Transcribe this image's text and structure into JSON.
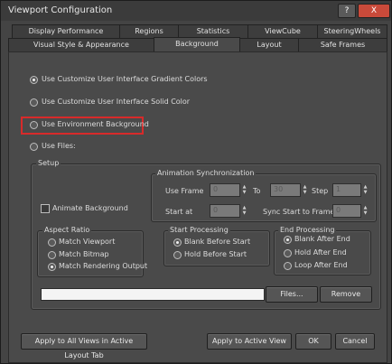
{
  "window": {
    "title": "Viewport Configuration",
    "help": "?",
    "close": "X"
  },
  "tabs_row1": [
    "Display Performance",
    "Regions",
    "Statistics",
    "ViewCube",
    "SteeringWheels"
  ],
  "tabs_row2": [
    "Visual Style & Appearance",
    "Background",
    "Layout",
    "Safe Frames"
  ],
  "options": {
    "gradient": "Use Customize User Interface Gradient Colors",
    "solid": "Use Customize User Interface Solid Color",
    "environment": "Use Environment Background",
    "files": "Use Files:",
    "selected": "gradient"
  },
  "setup": {
    "label": "Setup",
    "animate_background": "Animate Background",
    "animation_sync": {
      "label": "Animation Synchronization",
      "use_frame": "Use Frame",
      "use_frame_value": "0",
      "to": "To",
      "to_value": "30",
      "step": "Step",
      "step_value": "1",
      "start_at": "Start at",
      "start_at_value": "0",
      "sync_start": "Sync Start to Frame",
      "sync_start_value": "0"
    },
    "aspect_ratio": {
      "label": "Aspect Ratio",
      "match_viewport": "Match Viewport",
      "match_bitmap": "Match Bitmap",
      "match_rendering": "Match Rendering Output",
      "selected": "match_rendering"
    },
    "start_processing": {
      "label": "Start Processing",
      "blank_before": "Blank Before Start",
      "hold_before": "Hold Before Start",
      "selected": "blank_before"
    },
    "end_processing": {
      "label": "End Processing",
      "blank_after": "Blank After End",
      "hold_after": "Hold After End",
      "loop_after": "Loop After End",
      "selected": "blank_after"
    },
    "files_button": "Files...",
    "remove_button": "Remove"
  },
  "footer": {
    "apply_all": "Apply to All Views in Active Layout Tab",
    "apply_active": "Apply to Active View",
    "ok": "OK",
    "cancel": "Cancel"
  }
}
